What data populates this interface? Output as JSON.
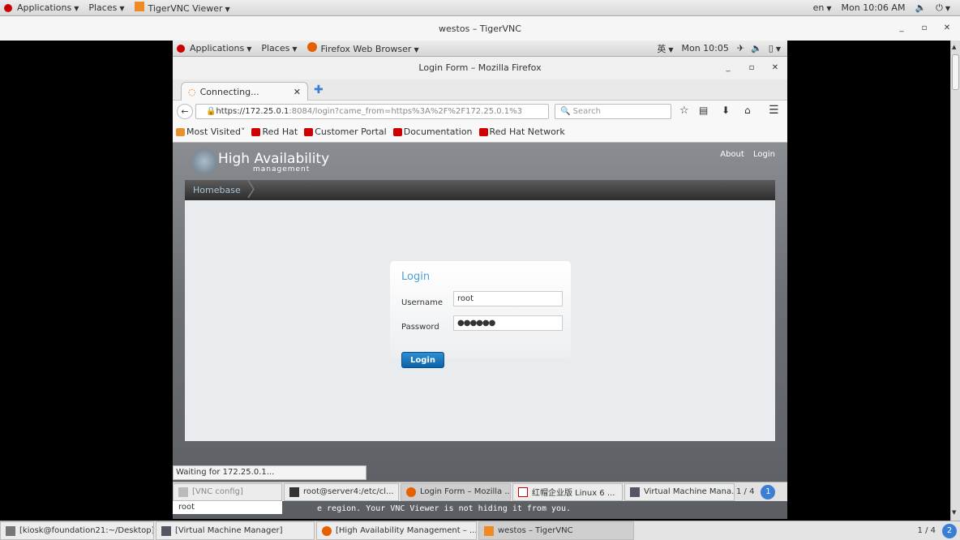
{
  "host_topbar": {
    "applications": "Applications",
    "places": "Places",
    "app": "TigerVNC Viewer",
    "lang": "en",
    "clock": "Mon 10:06 AM"
  },
  "vnc_window": {
    "title": "westos – TigerVNC"
  },
  "guest_topbar": {
    "applications": "Applications",
    "places": "Places",
    "app": "Firefox Web Browser",
    "ime": "英",
    "clock": "Mon 10:05"
  },
  "firefox": {
    "title": "Login Form – Mozilla Firefox",
    "tab_label": "Connecting...",
    "url_host": "https://172.25.0.1",
    "url_rest": ":8084/login?came_from=https%3A%2F%2F172.25.0.1%3",
    "search_placeholder": "Search",
    "bookmarks": [
      "Most Visited",
      "Red Hat",
      "Customer Portal",
      "Documentation",
      "Red Hat Network"
    ]
  },
  "page": {
    "brand": "High Availability",
    "brand_sub": "management",
    "links": [
      "About",
      "Login"
    ],
    "breadcrumb": "Homebase",
    "login": {
      "heading": "Login",
      "username_label": "Username",
      "username_value": "root",
      "password_label": "Password",
      "password_value": "●●●●●●",
      "button": "Login"
    }
  },
  "status_text": "Waiting for 172.25.0.1...",
  "guest_taskbar": {
    "items": [
      "[VNC config]",
      "root@server4:/etc/cl...",
      "Login Form – Mozilla ...",
      "红帽企业版 Linux 6 ...",
      "Virtual Machine Mana..."
    ],
    "pager": "1 / 4",
    "workspace": "1"
  },
  "root_box": "root",
  "vnc_message": "e region. Your VNC Viewer is not hiding it from you.",
  "host_taskbar": {
    "items": [
      "[kiosk@foundation21:~/Desktop]",
      "[Virtual Machine Manager]",
      "[High Availability Management – ...",
      "westos – TigerVNC"
    ],
    "pager": "1 / 4",
    "workspace": "2"
  }
}
